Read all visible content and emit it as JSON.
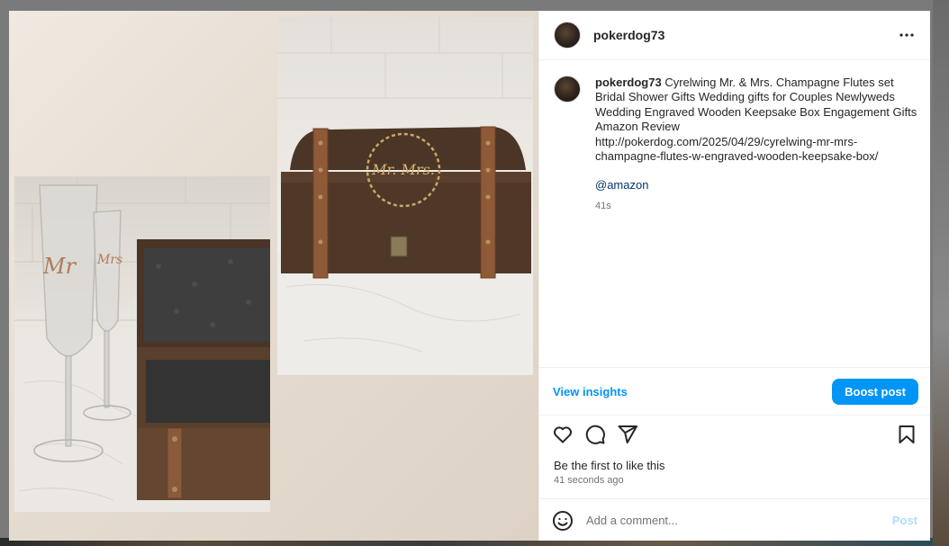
{
  "post": {
    "username": "pokerdog73",
    "caption": {
      "author": "pokerdog73",
      "text": "Cyrelwing Mr. & Mrs. Champagne Flutes set Bridal Shower Gifts Wedding gifts for Couples Newlyweds Wedding Engraved Wooden Keepsake Box Engagement Gifts\nAmazon Review\nhttp://pokerdog.com/2025/04/29/cyrelwing-mr-mrs-champagne-flutes-w-engraved-wooden-keepsake-box/",
      "mention": "@amazon",
      "time": "41s"
    },
    "photo_engravings": {
      "flute_left": "Mr",
      "flute_right": "Mrs",
      "box_lid": "Mr. Mrs."
    }
  },
  "insights": {
    "view_label": "View insights",
    "boost_label": "Boost post"
  },
  "actions": {
    "icons": [
      "heart-icon",
      "comment-icon",
      "share-icon",
      "bookmark-icon"
    ]
  },
  "engagement": {
    "likes_text": "Be the first to like this",
    "posted_time": "41 seconds ago"
  },
  "comment": {
    "placeholder": "Add a comment...",
    "post_label": "Post",
    "emoji_icon": "smiley-icon"
  },
  "colors": {
    "accent": "#0095f6",
    "link": "#00376b",
    "muted": "#737373",
    "post_disabled": "#b3dbff"
  }
}
